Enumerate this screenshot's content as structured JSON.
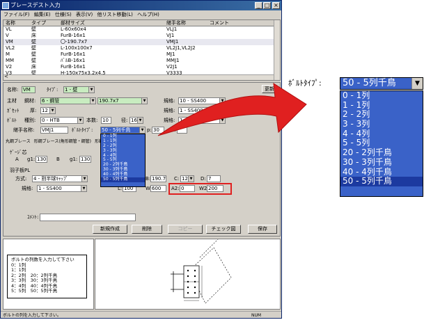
{
  "window": {
    "title": "ブレースデスト入力"
  },
  "menu": [
    "ファイル(F)",
    "編集(E)",
    "仕様(S)",
    "表示(V)",
    "他リスト移動(L)",
    "ヘルプ(H)"
  ],
  "list": {
    "headers": [
      "名称",
      "タイプ",
      "部材サイズ",
      "継手名称",
      "コメント"
    ],
    "rows": [
      [
        "VL",
        "壁",
        "L-60x60x4",
        "VLJ1",
        ""
      ],
      [
        "V",
        "床",
        "FurB-16x1",
        "VJ1",
        ""
      ],
      [
        "VM",
        "壁",
        "〇-190.7x7",
        "VMJ1",
        ""
      ],
      [
        "VL2",
        "壁",
        "L-100x100x7",
        "VL2J1,VL2J2",
        ""
      ],
      [
        "M",
        "壁",
        "FurB-16x1",
        "MJ1",
        ""
      ],
      [
        "MM",
        "壁",
        "ﾊﾞﾙB-16x1",
        "MMJ1",
        ""
      ],
      [
        "V2",
        "床",
        "FurB-16x1",
        "V2J1",
        ""
      ],
      [
        "V3",
        "壁",
        "H-150x75x3.2x4.5",
        "V3333",
        ""
      ]
    ],
    "arrow": "<"
  },
  "form": {
    "name_label": "名称:",
    "name_value": "VM",
    "type_label": "ﾀｲﾌﾟ:",
    "type_value": "1 - 壁",
    "update_button": "更新",
    "main_label": "主材",
    "steel_label": "鋼材:",
    "steel_value": "6 - 鋼管",
    "size_value": "190.7x7",
    "spec_label1": "規格:",
    "spec_value1": "10 - SS400",
    "gusset_label": "ｶﾞｾｯﾄ",
    "thickness_label": "厚:",
    "thickness_value": "12",
    "spec_label2": "規格:",
    "spec_value2": "1 - SS400",
    "bolt_label": "ﾎﾞﾙﾄ",
    "kind_label": "種別:",
    "kind_value": "0 - HTB",
    "count_label": "本数:",
    "count_value": "10",
    "dia_label": "径:",
    "dia_value": "16",
    "spec_label3": "規格:",
    "spec_value3": "1 - S10T",
    "joint_label": "継手名称:",
    "joint_value": "VMJ1",
    "bolt_type_label": "ﾎﾞﾙﾄﾀｲﾌﾟ:",
    "bolt_type_value": "50 - 5列千鳥",
    "p_label": "p:",
    "p_value": "30",
    "e_label": "e:",
    "tabs": [
      "丸鋼ブレース",
      "形鋼ブレース(角形鋼管・鋼管)",
      "形鋼ブ"
    ],
    "gauge_label": "ｹﾞｰｼﾞ芯",
    "a_label": "A",
    "g1_label": "g1:",
    "g1_value": "130",
    "b_label": "B",
    "g1b_label": "g1:",
    "g1b_value": "130",
    "plate_label": "羽子板PL",
    "method_label": "方式:",
    "method_value": "4 - 割半球ｷｬｯﾌﾟ",
    "b2_label": "B:",
    "b2_value": "190.7",
    "c_label": "C:",
    "c_value": "12",
    "d_label": "D:",
    "d_value": "7",
    "spec_label4": "規格:",
    "spec_value4": "1 - SS400",
    "l_label": "L:",
    "l_value": "100",
    "w_label": "W:",
    "w_value": "600",
    "a2_label": "A2:",
    "a2_value": "0",
    "w2_label": "W2:",
    "w2_value": "200",
    "comment_label": "ｺﾒﾝﾄ:"
  },
  "buttons": {
    "new": "新規作成",
    "delete": "削除",
    "copy": "コピー",
    "check": "チェック図",
    "save": "保存"
  },
  "bolt_options": [
    "0 - 1列",
    "1 - 1列",
    "2 - 2列",
    "3 - 3列",
    "4 - 4列",
    "5 - 5列",
    "20 - 2列千鳥",
    "30 - 3列千鳥",
    "40 - 4列千鳥",
    "50 - 5列千鳥"
  ],
  "info": {
    "title": "ボルトの列数を入力して下さい",
    "lines": [
      "0：1列",
      "1：1列",
      "2：2列　20：2列千鳥",
      "3：3列　30：3列千鳥",
      "4：4列　40：4列千鳥",
      "5：5列　50：5列千鳥"
    ]
  },
  "status": {
    "text": "ボルトの列を入力して下さい。",
    "num": "NUM"
  },
  "zoom": {
    "label": "ﾎﾞﾙﾄﾀｲﾌﾟ:",
    "value": "50 - 5列千鳥"
  },
  "colors": {
    "selection": "#3a62c8",
    "highlight_box": "#e02020",
    "arrow": "#e02020",
    "field_green": "#c8ecc0"
  }
}
